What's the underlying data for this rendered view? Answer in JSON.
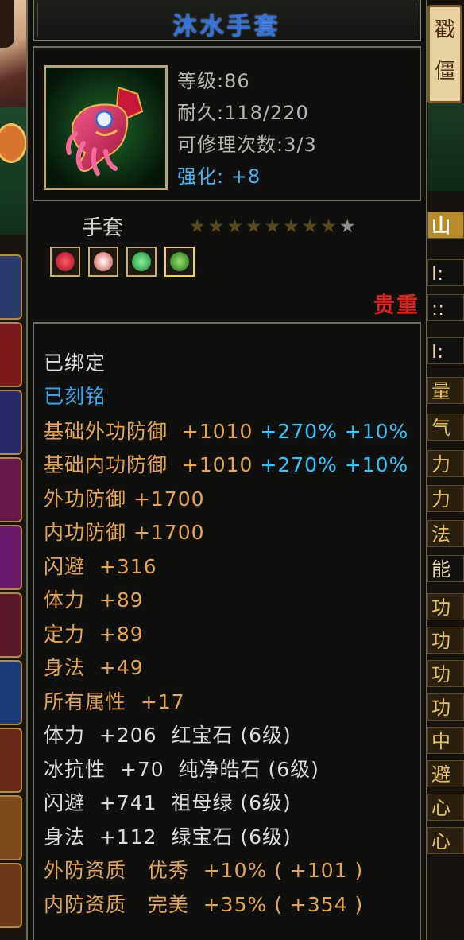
{
  "item": {
    "name": "沐水手套",
    "level": "等级:86",
    "durability": "耐久:118/220",
    "repairs": "可修理次数:3/3",
    "enhance": "强化: +8",
    "type": "手套",
    "stars_total": 9,
    "stars_lit": 1,
    "rarity": "贵重"
  },
  "gems": [
    {
      "icon": "red-ruby-gem-icon",
      "color": "#e0222c"
    },
    {
      "icon": "white-diamond-gem-icon",
      "color": "#c8c8d8"
    },
    {
      "icon": "green-emerald-gem-icon",
      "color": "#22b44a"
    },
    {
      "icon": "green-jade-gem-icon",
      "color": "#3aa02a"
    }
  ],
  "status": {
    "bound": "已绑定",
    "engraved": "已刻铭"
  },
  "attributes": {
    "base_ext_def": {
      "label": "基础外功防御  +1010",
      "pct": " +270%",
      "bonus": " +10%"
    },
    "base_int_def": {
      "label": "基础内功防御  +1010",
      "pct": " +270%",
      "bonus": " +10%"
    },
    "ext_def": "外功防御 +1700",
    "int_def": "内功防御 +1700",
    "dodge": "闪避  +316",
    "stamina": "体力  +89",
    "focus": "定力  +89",
    "agility": "身法  +49",
    "all_attr": "所有属性  +17",
    "gem_stamina": "体力  +206  红宝石 (6级)",
    "gem_ice": "冰抗性  +70  纯净皓石 (6级)",
    "gem_dodge": "闪避  +741  祖母绿 (6级)",
    "gem_agility": "身法  +112  绿宝石 (6级)",
    "ext_aptitude": "外防资质   优秀  +10% ( +101 )",
    "int_aptitude": "内防资质   完美  +35% ( +354 )"
  },
  "background": {
    "left_icon_slots": 10,
    "right_scroll_glyphs": [
      "戳",
      "僵"
    ],
    "right_tabs": [
      "山",
      "I:",
      "::",
      "I:",
      "量",
      "气",
      "力",
      "力",
      "法",
      "能",
      "功",
      "功",
      "功",
      "功",
      "中",
      "避",
      "心",
      "心"
    ]
  },
  "colors": {
    "title": "#2f72e0",
    "enhance": "#4ab4f0",
    "rarity": "#e0221c",
    "gold_attr": "#e4a650",
    "blue_pct": "#2ec8ff"
  }
}
